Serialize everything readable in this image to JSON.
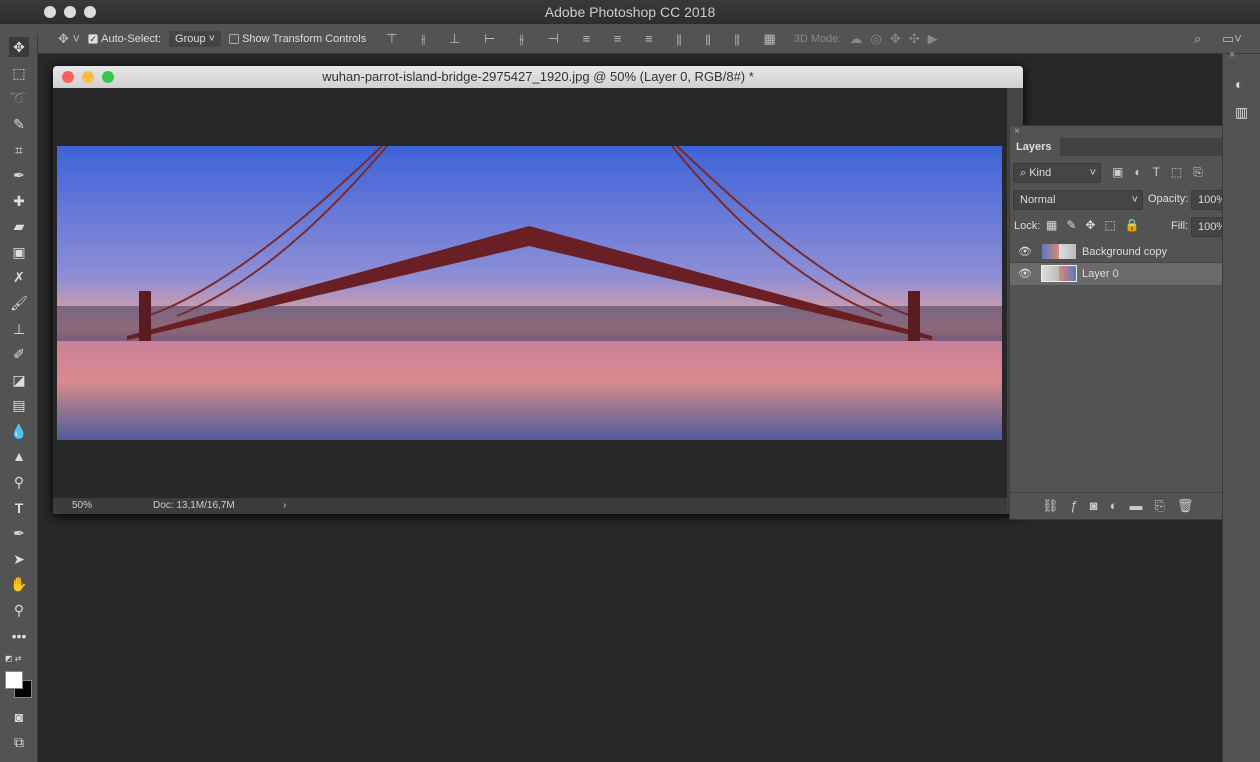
{
  "app": {
    "title": "Adobe Photoshop CC 2018"
  },
  "options": {
    "auto_select_label": "Auto-Select:",
    "auto_select_checked": true,
    "group_value": "Group",
    "show_transform_label": "Show Transform Controls",
    "show_transform_checked": false,
    "mode_3d_label": "3D Mode:"
  },
  "document": {
    "title": "wuhan-parrot-island-bridge-2975427_1920.jpg @ 50% (Layer 0, RGB/8#) *",
    "zoom": "50%",
    "doc_size": "Doc: 13,1M/16,7M"
  },
  "layers_panel": {
    "tab": "Layers",
    "filter_kind": "Kind",
    "blend_mode": "Normal",
    "opacity_label": "Opacity:",
    "opacity": "100%",
    "lock_label": "Lock:",
    "fill_label": "Fill:",
    "fill": "100%",
    "layers": [
      {
        "name": "Background copy",
        "visible": true,
        "selected": false
      },
      {
        "name": "Layer 0",
        "visible": true,
        "selected": true
      }
    ]
  },
  "colors": {
    "foreground": "#ffffff",
    "background": "#000000",
    "panel": "#535353",
    "workspace": "#282828"
  }
}
